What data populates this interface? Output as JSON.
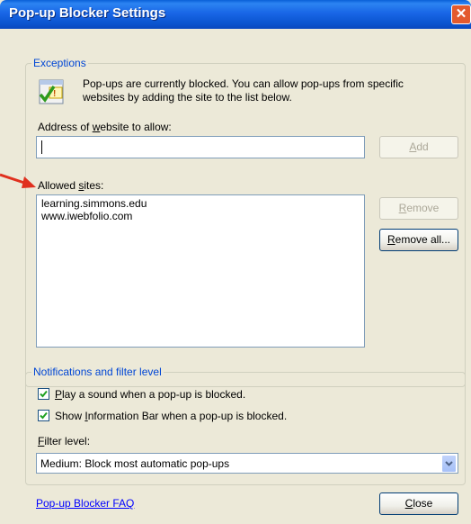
{
  "window": {
    "title": "Pop-up Blocker Settings"
  },
  "exceptions": {
    "group_label": "Exceptions",
    "info_text_line1": "Pop-ups are currently blocked.  You can allow pop-ups from specific",
    "info_text_line2": "websites by adding the site to the list below.",
    "address_label_pre": "Address of ",
    "address_label_u": "w",
    "address_label_post": "ebsite to allow:",
    "address_value": "",
    "add_button": {
      "u": "A",
      "rest": "dd"
    },
    "allowed_label_pre": "Allowed ",
    "allowed_label_u": "s",
    "allowed_label_post": "ites:",
    "allowed_sites": [
      "learning.simmons.edu",
      "www.iwebfolio.com"
    ],
    "remove_button": {
      "u": "R",
      "rest": "emove"
    },
    "remove_all_button": {
      "u": "R",
      "rest": "emove all..."
    }
  },
  "notifications": {
    "group_label": "Notifications and filter level",
    "play_sound": {
      "u": "P",
      "rest": "lay a sound when a pop-up is blocked.",
      "checked": true
    },
    "show_info_bar": {
      "pre": "Show ",
      "u": "I",
      "rest": "nformation Bar when a pop-up is blocked.",
      "checked": true
    },
    "filter_label": {
      "u": "F",
      "rest": "ilter level:"
    },
    "filter_value": "Medium: Block most automatic pop-ups"
  },
  "footer": {
    "faq_link": "Pop-up Blocker FAQ",
    "close_button": {
      "u": "C",
      "rest": "lose"
    }
  },
  "colors": {
    "titlebar": "#0A5FD8",
    "dialog_bg": "#ECE9D8",
    "group_label": "#0046D5",
    "arrow": "#E0301E"
  },
  "icons": [
    "popup-info-icon",
    "close-icon",
    "checkmark-icon",
    "dropdown-arrow-icon",
    "red-arrow-annotation"
  ]
}
